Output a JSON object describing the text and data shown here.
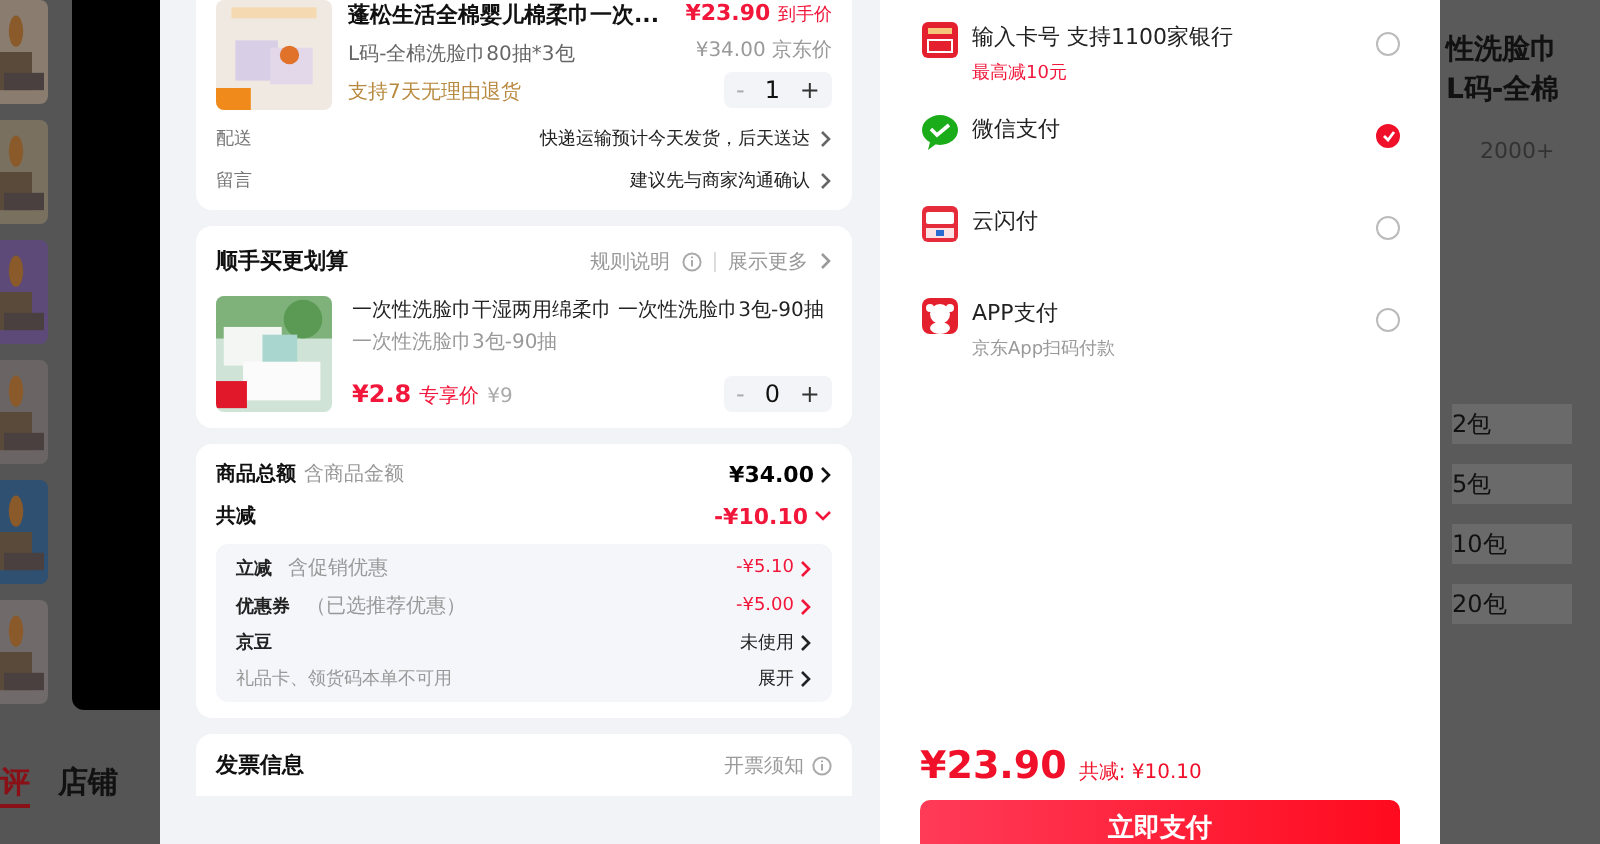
{
  "background_page": {
    "tabs": [
      {
        "label": "评",
        "selected": true
      },
      {
        "label": "店铺",
        "selected": false
      }
    ],
    "right_texts": [
      "性洗脸巾",
      "L码-全棉",
      "2000+"
    ],
    "options": [
      "2包",
      "5包",
      "10包",
      "20包"
    ]
  },
  "order": {
    "product": {
      "title": "蓬松生活全棉婴儿棉柔巾一次...",
      "spec": "L码-全棉洗脸巾80抽*3包",
      "service": "支持7天无理由退货",
      "price": "¥23.90",
      "price_label": "到手价",
      "jd_price": "¥34.00",
      "jd_price_label": "京东价",
      "quantity": "1",
      "minus": "-",
      "plus": "+"
    },
    "info_rows": [
      {
        "label": "配送",
        "value": "快递运输预计今天发货，后天送达"
      },
      {
        "label": "留言",
        "value": "建议先与商家沟通确认"
      }
    ]
  },
  "addon": {
    "title": "顺手买更划算",
    "rules": "规则说明",
    "more": "展示更多",
    "item": {
      "title": "一次性洗脸巾干湿两用绵柔巾 一次性洗脸巾3包-90抽",
      "spec": "一次性洗脸巾3包-90抽",
      "price": "¥2.8",
      "price_label": "专享价",
      "original": "¥9",
      "quantity": "0",
      "minus": "-",
      "plus": "+"
    }
  },
  "summary": {
    "total_label": "商品总额",
    "total_hint": "含商品金额",
    "total": "¥34.00",
    "discount_label": "共减",
    "discount": "-¥10.10",
    "expanded": true,
    "details": [
      {
        "label": "立减",
        "hint": "含促销优惠",
        "value": "-¥5.10",
        "kind": "discount"
      },
      {
        "label": "优惠券",
        "hint": "（已选推荐优惠）",
        "value": "-¥5.00",
        "kind": "discount"
      },
      {
        "label": "京豆",
        "value": "未使用",
        "kind": "plain"
      },
      {
        "label": "礼品卡、领货码本单不可用",
        "value": "展开",
        "kind": "muted"
      }
    ]
  },
  "invoice": {
    "title": "发票信息",
    "hint": "开票须知"
  },
  "payment": {
    "methods": [
      {
        "name": "输入卡号 支持1100家银行",
        "note": "最高减10元",
        "kind": "promo",
        "selected": false
      },
      {
        "name": "微信支付",
        "selected": true
      },
      {
        "name": "云闪付",
        "selected": false
      },
      {
        "name": "APP支付",
        "note": "京东App扫码付款",
        "kind": "plain",
        "selected": false
      }
    ],
    "total": "¥23.90",
    "saved": "共减: ¥10.10",
    "pay_button": "立即支付"
  }
}
